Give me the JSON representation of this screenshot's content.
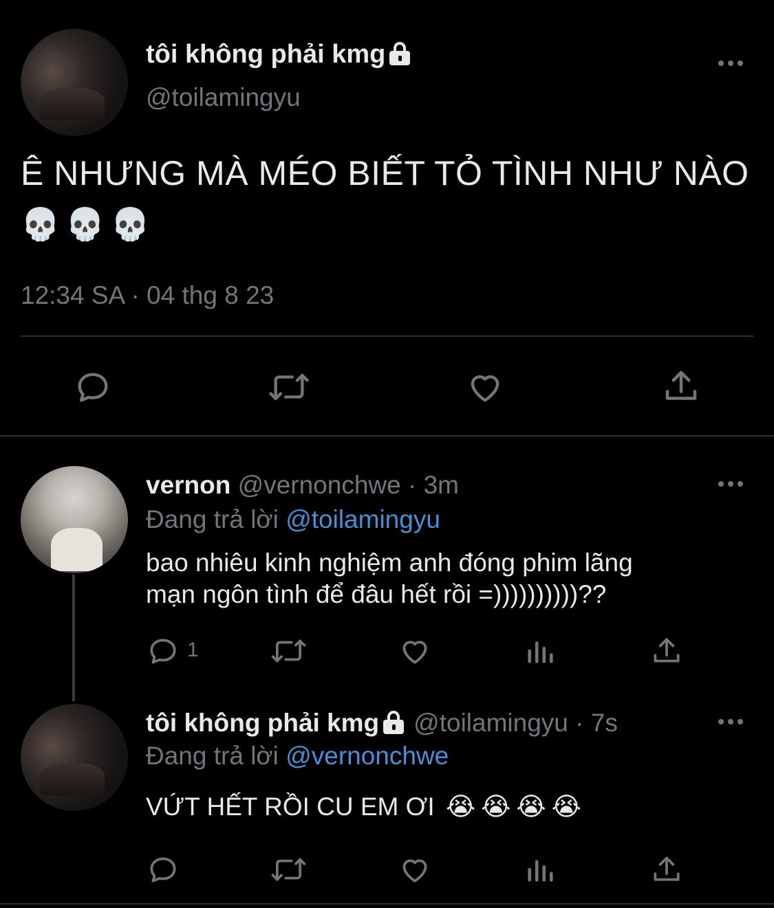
{
  "main_tweet": {
    "display_name": "tôi không phải kmg",
    "handle": "@toilamingyu",
    "text": "Ê NHƯNG MÀ MÉO BIẾT TỎ TÌNH NHƯ NÀO",
    "emojis": [
      "💀",
      "💀",
      "💀"
    ],
    "timestamp": "12:34 SA · 04 thg 8 23"
  },
  "reply_1": {
    "display_name": "vernon",
    "handle_time": "@vernonchwe · 3m",
    "replying_prefix": "Đang trả lời",
    "replying_to": "@toilamingyu",
    "text_line1": "bao nhiêu kinh nghiệm anh đóng phim lãng",
    "text_line2": "mạn ngôn tình để đâu hết rồi =))))))))))??",
    "reply_count": "1"
  },
  "reply_2": {
    "display_name": "tôi không phải kmg",
    "handle_time": "@toilamingyu · 7s",
    "replying_prefix": "Đang trả lời",
    "replying_to": "@vernonchwe",
    "text": "VỨT HẾT RỒI CU EM ƠI",
    "emojis": [
      "😭",
      "😭",
      "😭",
      "😭"
    ]
  },
  "icons": {
    "reply": "speech-bubble-icon",
    "retweet": "retweet-icon",
    "like": "heart-icon",
    "views": "bar-chart-icon",
    "share": "share-icon",
    "more": "more-dots-icon",
    "lock": "lock-icon"
  },
  "colors": {
    "background": "#000000",
    "text": "#e7e9ea",
    "muted": "#71767b",
    "link": "#4a8fd6",
    "divider": "#2f3336"
  }
}
